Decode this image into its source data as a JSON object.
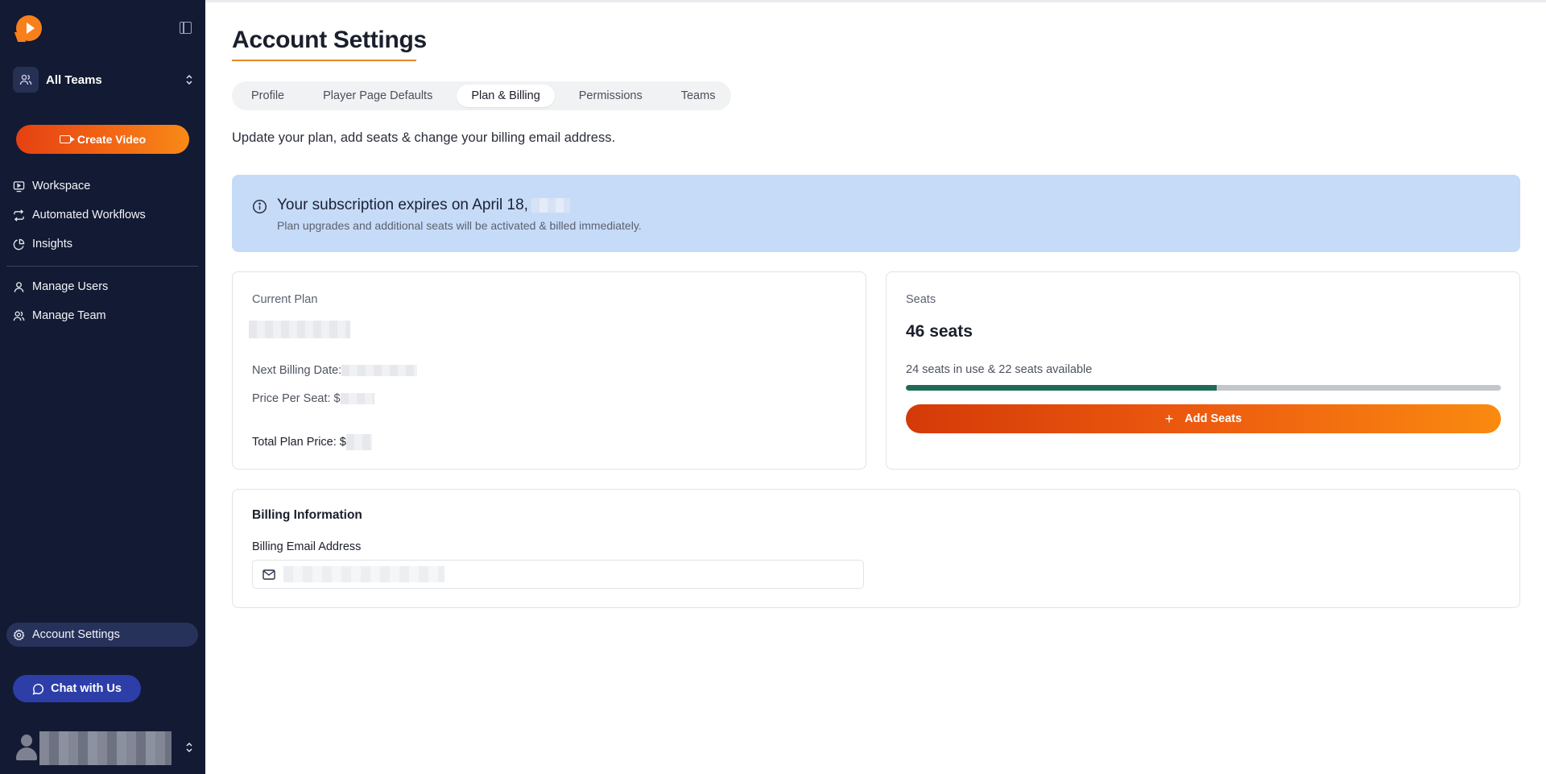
{
  "sidebar": {
    "team": {
      "label": "All Teams"
    },
    "create_button": "Create Video",
    "nav_primary": [
      {
        "label": "Workspace",
        "icon": "workspace-icon"
      },
      {
        "label": "Automated Workflows",
        "icon": "workflow-icon"
      },
      {
        "label": "Insights",
        "icon": "pie-chart-icon"
      }
    ],
    "nav_secondary": [
      {
        "label": "Manage Users",
        "icon": "user-icon"
      },
      {
        "label": "Manage Team",
        "icon": "users-icon"
      }
    ],
    "account_settings": {
      "label": "Account Settings",
      "icon": "gear-icon",
      "active": true
    },
    "chat_button": "Chat with Us"
  },
  "main": {
    "title": "Account Settings",
    "tabs": [
      {
        "label": "Profile",
        "active": false
      },
      {
        "label": "Player Page Defaults",
        "active": false
      },
      {
        "label": "Plan & Billing",
        "active": true
      },
      {
        "label": "Permissions",
        "active": false
      },
      {
        "label": "Teams",
        "active": false
      }
    ],
    "subtitle": "Update your plan, add seats & change your billing email address.",
    "alert": {
      "title": "Your subscription expires on April 18,",
      "subtitle": "Plan upgrades and additional seats will be activated & billed immediately."
    },
    "plan": {
      "label": "Current Plan",
      "next_billing_label": "Next Billing Date:",
      "price_per_seat_label": "Price Per Seat: $",
      "total_price_label": "Total Plan Price: $"
    },
    "seats": {
      "label": "Seats",
      "count_text": "46 seats",
      "usage_text": "24 seats in use & 22 seats available",
      "in_use": 24,
      "total": 46,
      "add_button": "Add Seats"
    },
    "billing": {
      "title": "Billing Information",
      "email_label": "Billing Email Address"
    }
  },
  "colors": {
    "sidebar_bg": "#131a33",
    "accent_orange": "#f36a15",
    "chat_blue": "#2d3ea8",
    "alert_bg": "#c6dbf7",
    "progress_fill": "#1f6b57",
    "title_underline": "#e08a25"
  }
}
